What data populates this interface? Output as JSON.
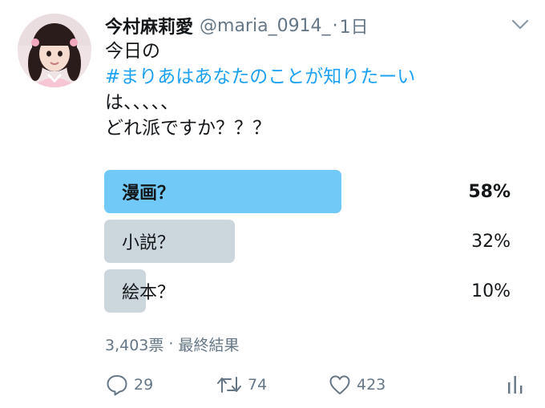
{
  "tweet": {
    "author_name": "今村麻莉愛",
    "author_handle": "@maria_0914_",
    "separator": "·",
    "timestamp": "1日",
    "text_lines": [
      "今日の",
      "#まりあはあなたのことが知りたーい",
      "は、、、、、",
      "どれ派ですか？？？"
    ]
  },
  "poll": {
    "options": [
      {
        "label": "漫画？",
        "percent_text": "58%",
        "percent": 58,
        "winner": true
      },
      {
        "label": "小説？",
        "percent_text": "32%",
        "percent": 32,
        "winner": false
      },
      {
        "label": "絵本？",
        "percent_text": "10%",
        "percent": 10,
        "winner": false
      }
    ],
    "votes": "3,403票",
    "status": "最終結果"
  },
  "actions": {
    "replies": "29",
    "retweets": "74",
    "likes": "423"
  },
  "colors": {
    "hashtag": "#1da1f2",
    "winner_bar": "#71c9f8",
    "other_bar": "#ccd6dd",
    "secondary_text": "#657786"
  }
}
